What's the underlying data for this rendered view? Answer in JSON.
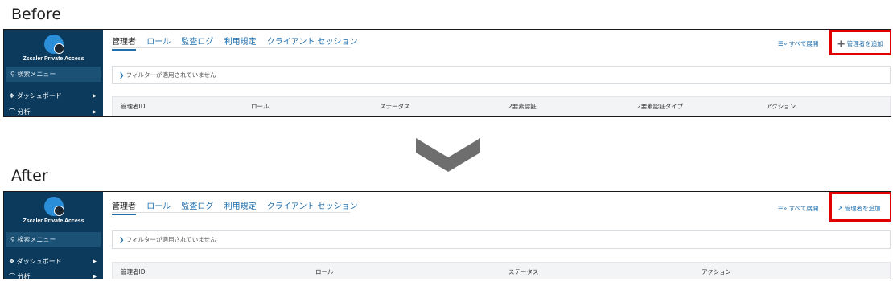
{
  "labels": {
    "before": "Before",
    "after": "After"
  },
  "app": {
    "brand": "Zscaler Private Access",
    "search_placeholder": "検索メニュー",
    "nav": [
      {
        "label": "ダッシュボード"
      },
      {
        "label": "分析"
      }
    ],
    "tabs": [
      "管理者",
      "ロール",
      "監査ログ",
      "利用規定",
      "クライアント セッション"
    ],
    "expand_all": "すべて展開",
    "add_admin": "管理者を追加",
    "filter_text": "フィルターが適用されていません"
  },
  "before": {
    "columns": [
      "管理者ID",
      "ロール",
      "ステータス",
      "2要素認証",
      "2要素認証タイプ",
      "アクション"
    ],
    "add_icon": "plus-circle-icon"
  },
  "after": {
    "columns": [
      "管理者ID",
      "ロール",
      "ステータス",
      "アクション"
    ],
    "add_icon": "external-link-icon"
  },
  "colors": {
    "sidebar": "#0b3a5c",
    "accent": "#1f6fae",
    "highlight": "#e00000",
    "arrow": "#6e6e6e"
  }
}
